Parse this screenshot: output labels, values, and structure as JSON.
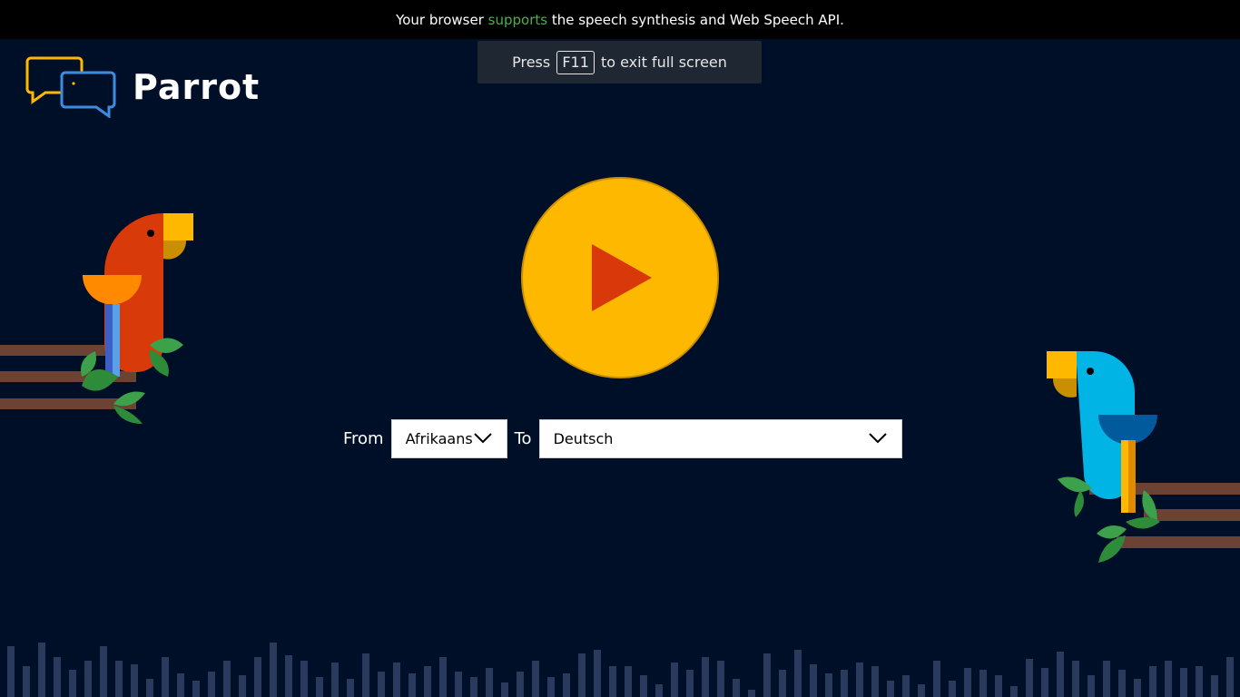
{
  "banner": {
    "prefix": "Your browser ",
    "highlight": "supports",
    "suffix": " the speech synthesis and Web Speech API."
  },
  "fullscreen_toast": {
    "prefix": "Press",
    "key": "F11",
    "suffix": "to exit full screen"
  },
  "app": {
    "title": "Parrot"
  },
  "language": {
    "from_label": "From",
    "from_value": "Afrikaans",
    "to_label": "To",
    "to_value": "Deutsch"
  },
  "colors": {
    "background": "#000f28",
    "accent_yellow": "#ffb800",
    "play_triangle": "#d9380a",
    "supports_green": "#4caf50",
    "bars": "#2a3a5c"
  },
  "icons": {
    "logo": "chat-bubbles-icon",
    "play": "play-icon",
    "dropdown": "chevron-down-icon"
  }
}
